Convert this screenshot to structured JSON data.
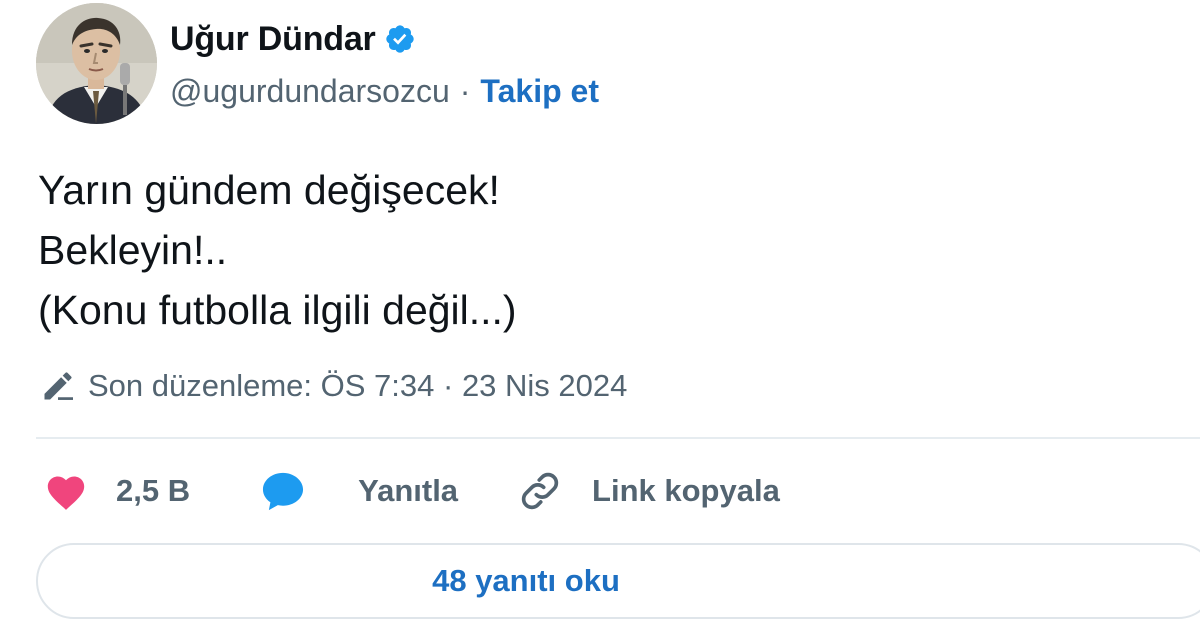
{
  "author": {
    "name": "Uğur Dündar",
    "handle": "@ugurdundarsozcu",
    "separator": "·",
    "follow_label": "Takip et",
    "verified_icon": "verified-badge-icon",
    "avatar_icon": "profile-avatar"
  },
  "tweet": {
    "lines": [
      "Yarın gündem değişecek!",
      "Bekleyin!..",
      "(Konu futbolla ilgili değil...)"
    ],
    "edited_label": "Son düzenleme: ÖS 7:34 · 23 Nis 2024",
    "edited_icon": "pencil-icon"
  },
  "actions": {
    "like_icon": "heart-icon",
    "like_count": "2,5 B",
    "reply_icon": "speech-bubble-icon",
    "reply_label": "Yanıtla",
    "copy_icon": "link-icon",
    "copy_label": "Link kopyala"
  },
  "read_replies_label": "48 yanıtı oku",
  "colors": {
    "accent": "#1d6fc2",
    "verified": "#1d9bf0",
    "like": "#f0457d",
    "muted": "#536471",
    "text": "#0f1419"
  }
}
